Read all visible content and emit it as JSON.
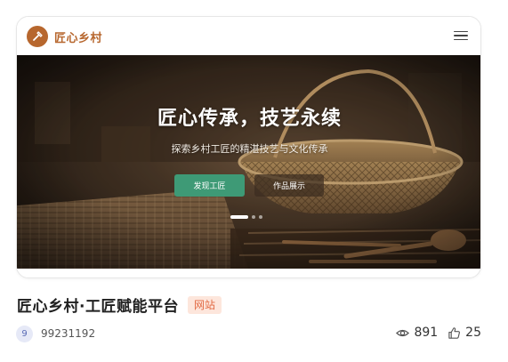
{
  "nav": {
    "brand": "匠心乡村",
    "logo_icon": "hammer-icon",
    "menu_icon": "hamburger-menu-icon"
  },
  "hero": {
    "title": "匠心传承，技艺永续",
    "subtitle": "探索乡村工匠的精湛技艺与文化传承",
    "primary_button": "发现工匠",
    "secondary_button": "作品展示",
    "slides": 3,
    "active_slide": 1
  },
  "post": {
    "title": "匠心乡村·工匠赋能平台",
    "tag": "网站",
    "avatar_text": "9",
    "user_id": "99231192",
    "views": "891",
    "likes": "25"
  },
  "colors": {
    "brand": "#b7672e",
    "primary_button": "#3e9a76",
    "tag_bg": "#fde6dc",
    "tag_text": "#e26a44"
  }
}
